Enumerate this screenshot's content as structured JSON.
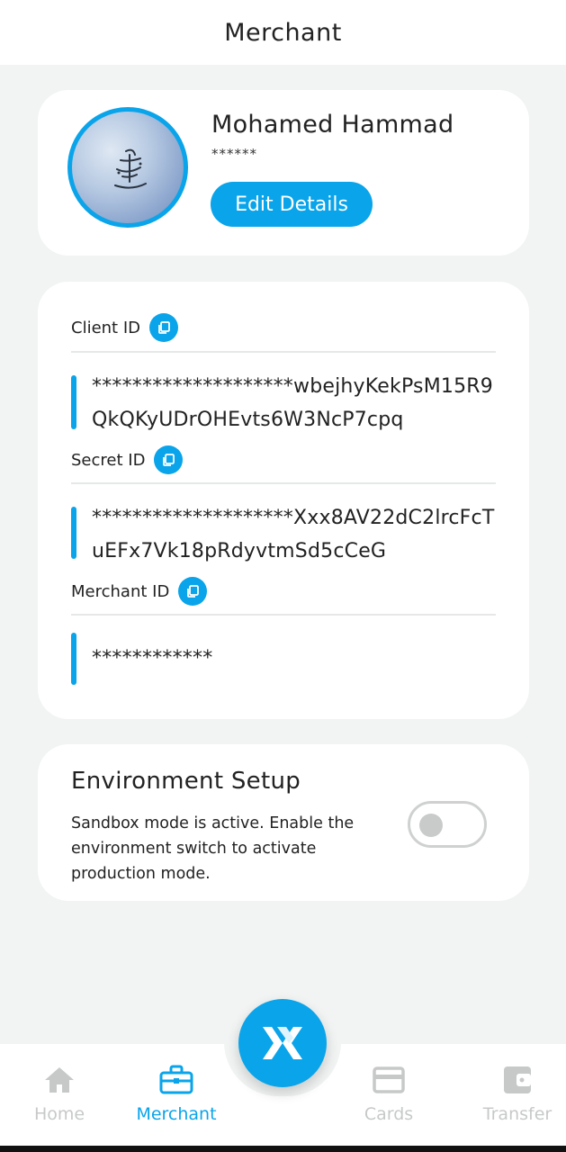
{
  "header": {
    "title": "Merchant"
  },
  "profile": {
    "name": "Mohamed Hammad",
    "masked": "******",
    "edit_label": "Edit Details"
  },
  "credentials": {
    "client": {
      "label": "Client ID",
      "value": "********************wbejhyKekPsM15R9QkQKyUDrOHEvts6W3NcP7cpq"
    },
    "secret": {
      "label": "Secret ID",
      "value": "********************Xxx8AV22dC2lrcFcTuEFx7Vk18pRdyvtmSd5cCeG"
    },
    "merchant": {
      "label": "Merchant ID",
      "value": "************"
    }
  },
  "environment": {
    "title": "Environment Setup",
    "description": "Sandbox mode is active. Enable the environment switch to activate production mode.",
    "production_enabled": false
  },
  "nav": {
    "items": [
      {
        "label": "Home",
        "icon": "home-icon",
        "active": false
      },
      {
        "label": "Merchant",
        "icon": "briefcase-icon",
        "active": true
      },
      {
        "label": "Cards",
        "icon": "card-icon",
        "active": false
      },
      {
        "label": "Transfer",
        "icon": "wallet-icon",
        "active": false
      }
    ],
    "fab_icon": "brand-logo-icon"
  },
  "colors": {
    "accent": "#0aa4ea",
    "background": "#f1f4f3",
    "inactive": "#c7c9c9"
  }
}
